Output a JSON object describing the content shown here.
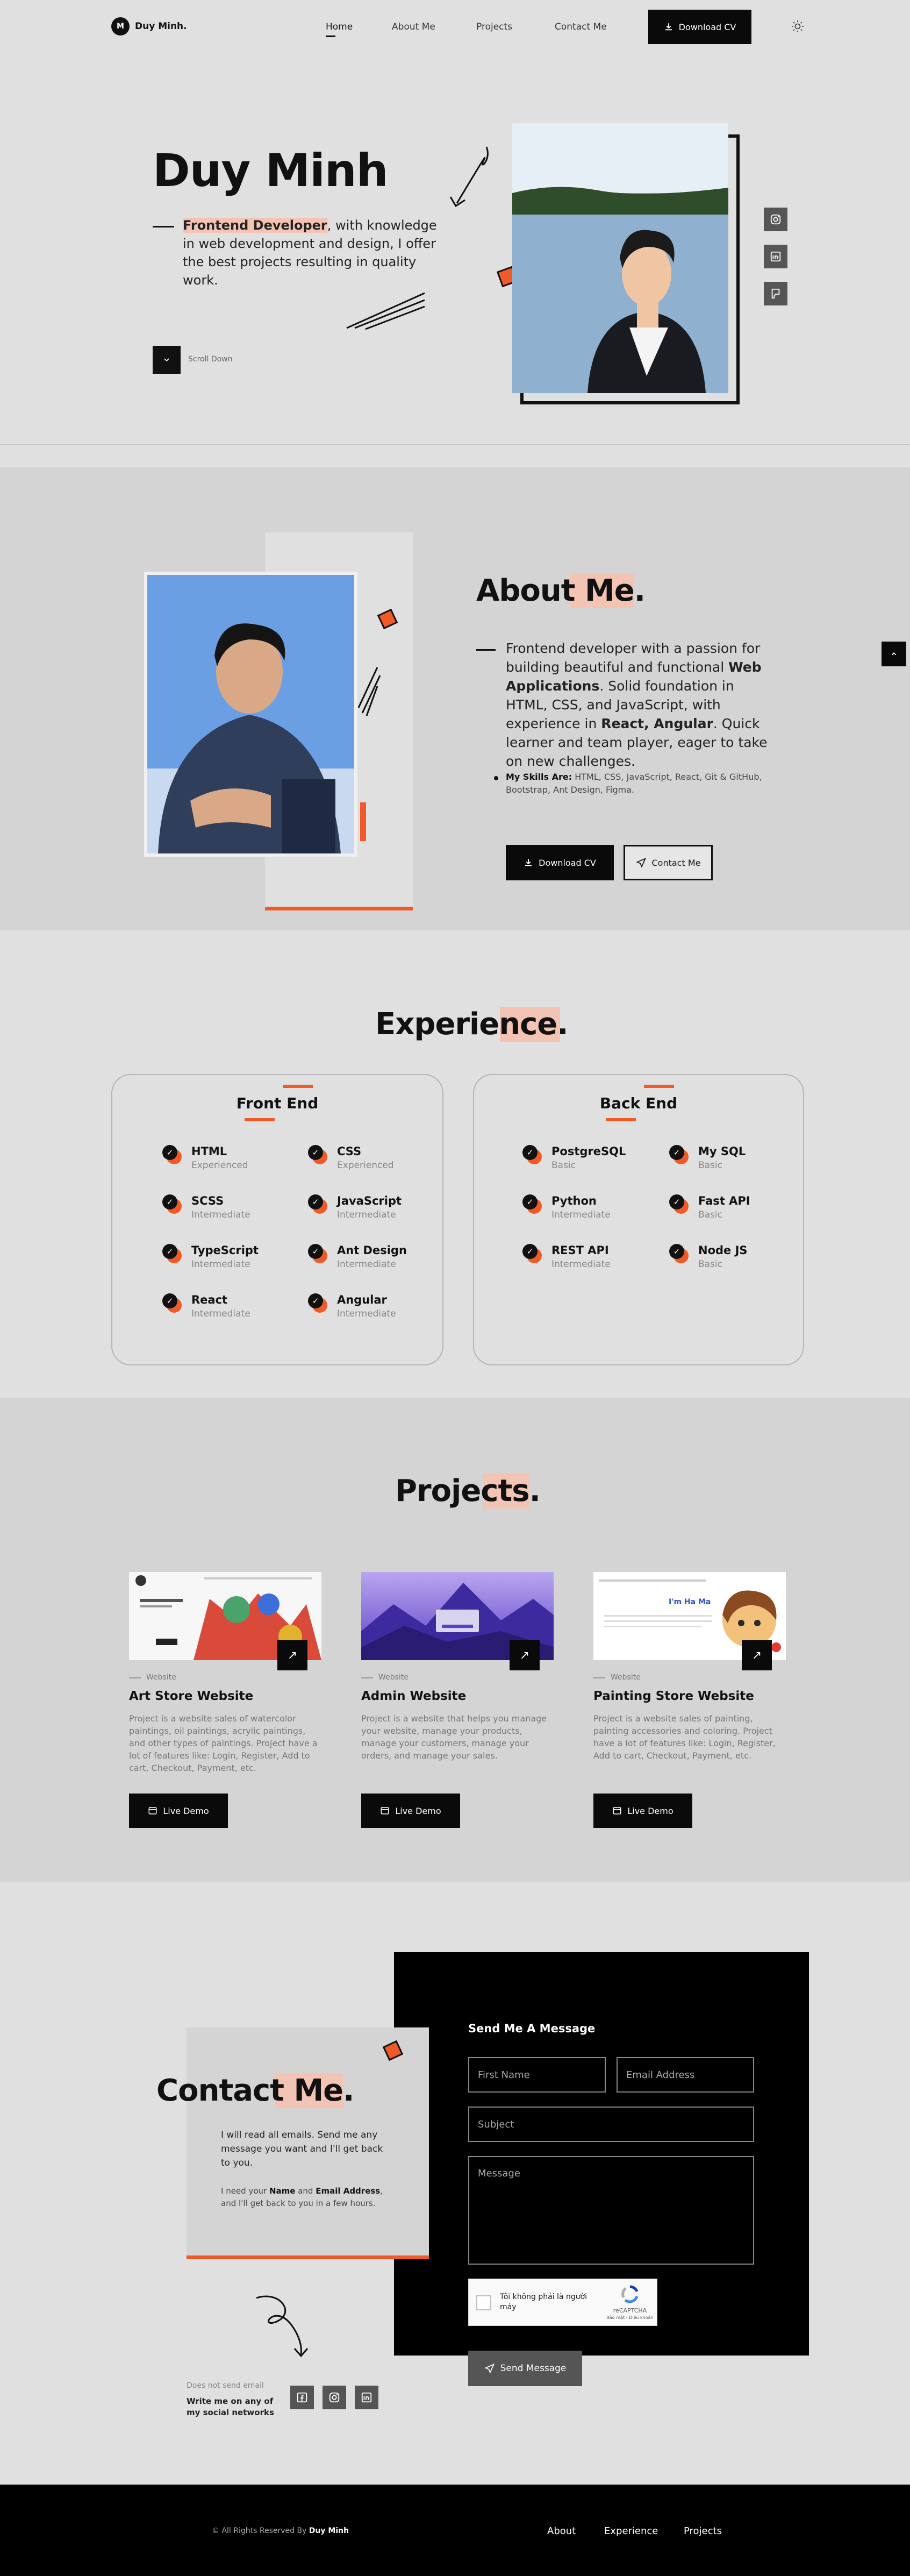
{
  "nav": {
    "logo_letter": "M",
    "brand": "Duy Minh.",
    "items": [
      "Home",
      "About Me",
      "Projects",
      "Contact Me"
    ],
    "download_label": "Download CV",
    "theme_icon": "sun-icon"
  },
  "hero": {
    "name": "Duy Minh",
    "role": "Frontend Developer",
    "intro_rest": ", with knowledge in web development and design, I offer the best projects resulting in quality work.",
    "scroll_label": "Scroll Down",
    "socials": [
      "instagram-icon",
      "linkedin-icon",
      "portfolio-icon"
    ]
  },
  "about": {
    "title": "About Me",
    "p_1": "Frontend developer with a passion for building beautiful and functional ",
    "p_bold_1": "Web Applications",
    "p_2": ". Solid foundation in HTML, CSS, and JavaScript, with experience in ",
    "p_bold_2": "React, Angular",
    "p_3": ". Quick learner and team player, eager to take on new challenges.",
    "skills_label": "My Skills Are:",
    "skills_text": " HTML, CSS, JavaScript, React, Git & GitHub, Bootstrap, Ant Design, Figma.",
    "download_label": "Download CV",
    "contact_label": "Contact Me"
  },
  "experience": {
    "title": "Experience",
    "front": {
      "heading": "Front End",
      "skills": [
        {
          "name": "HTML",
          "level": "Experienced"
        },
        {
          "name": "CSS",
          "level": "Experienced"
        },
        {
          "name": "SCSS",
          "level": "Intermediate"
        },
        {
          "name": "JavaScript",
          "level": "Intermediate"
        },
        {
          "name": "TypeScript",
          "level": "Intermediate"
        },
        {
          "name": "Ant Design",
          "level": "Intermediate"
        },
        {
          "name": "React",
          "level": "Intermediate"
        },
        {
          "name": "Angular",
          "level": "Intermediate"
        }
      ]
    },
    "back": {
      "heading": "Back End",
      "skills": [
        {
          "name": "PostgreSQL",
          "level": "Basic"
        },
        {
          "name": "My SQL",
          "level": "Basic"
        },
        {
          "name": "Python",
          "level": "Intermediate"
        },
        {
          "name": "Fast API",
          "level": "Basic"
        },
        {
          "name": "REST API",
          "level": "Intermediate"
        },
        {
          "name": "Node JS",
          "level": "Basic"
        }
      ]
    }
  },
  "projects": {
    "title": "Projects",
    "items": [
      {
        "tag": "Website",
        "title": "Art Store Website",
        "desc": "Project is a website sales of watercolor paintings, oil paintings, acrylic paintings, and other types of paintings. Project have a lot of features like: Login, Register, Add to cart, Checkout, Payment, etc.",
        "demo": "Live Demo"
      },
      {
        "tag": "Website",
        "title": "Admin Website",
        "desc": "Project is a website that helps you manage your website, manage your products, manage your customers, manage your orders, and manage your sales.",
        "demo": "Live Demo"
      },
      {
        "tag": "Website",
        "title": "Painting Store Website",
        "desc": "Project is a website sales of painting, painting accessories and coloring. Project have a lot of features like: Login, Register, Add to cart, Checkout, Payment, etc.",
        "demo": "Live Demo"
      }
    ]
  },
  "contact": {
    "title": "Contact Me",
    "p1": "I will read all emails. Send me any message you want and I'll get back to you.",
    "p2_pre": "I need your ",
    "p2_b1": "Name",
    "p2_mid": " and ",
    "p2_b2": "Email Address",
    "p2_post": ", and I'll get back to you in a few hours.",
    "no_email": "Does not send email",
    "write_me": "Write me on any of my social networks",
    "form_title": "Send Me A Message",
    "first_name": "First Name",
    "email": "Email Address",
    "subject": "Subject",
    "message": "Message",
    "captcha_text": "Tôi không phải là người máy",
    "captcha_brand": "reCAPTCHA",
    "captcha_links": "Bảo mật - Điều khoản",
    "send_label": "Send Message"
  },
  "footer": {
    "copyright_pre": "© All Rights Reserved By ",
    "copyright_name": "Duy Minh",
    "links": [
      "About",
      "Experience",
      "Projects"
    ]
  },
  "colors": {
    "accent": "#f05a28",
    "highlight": "#f3c4b3",
    "dark": "#0a0a0a"
  }
}
